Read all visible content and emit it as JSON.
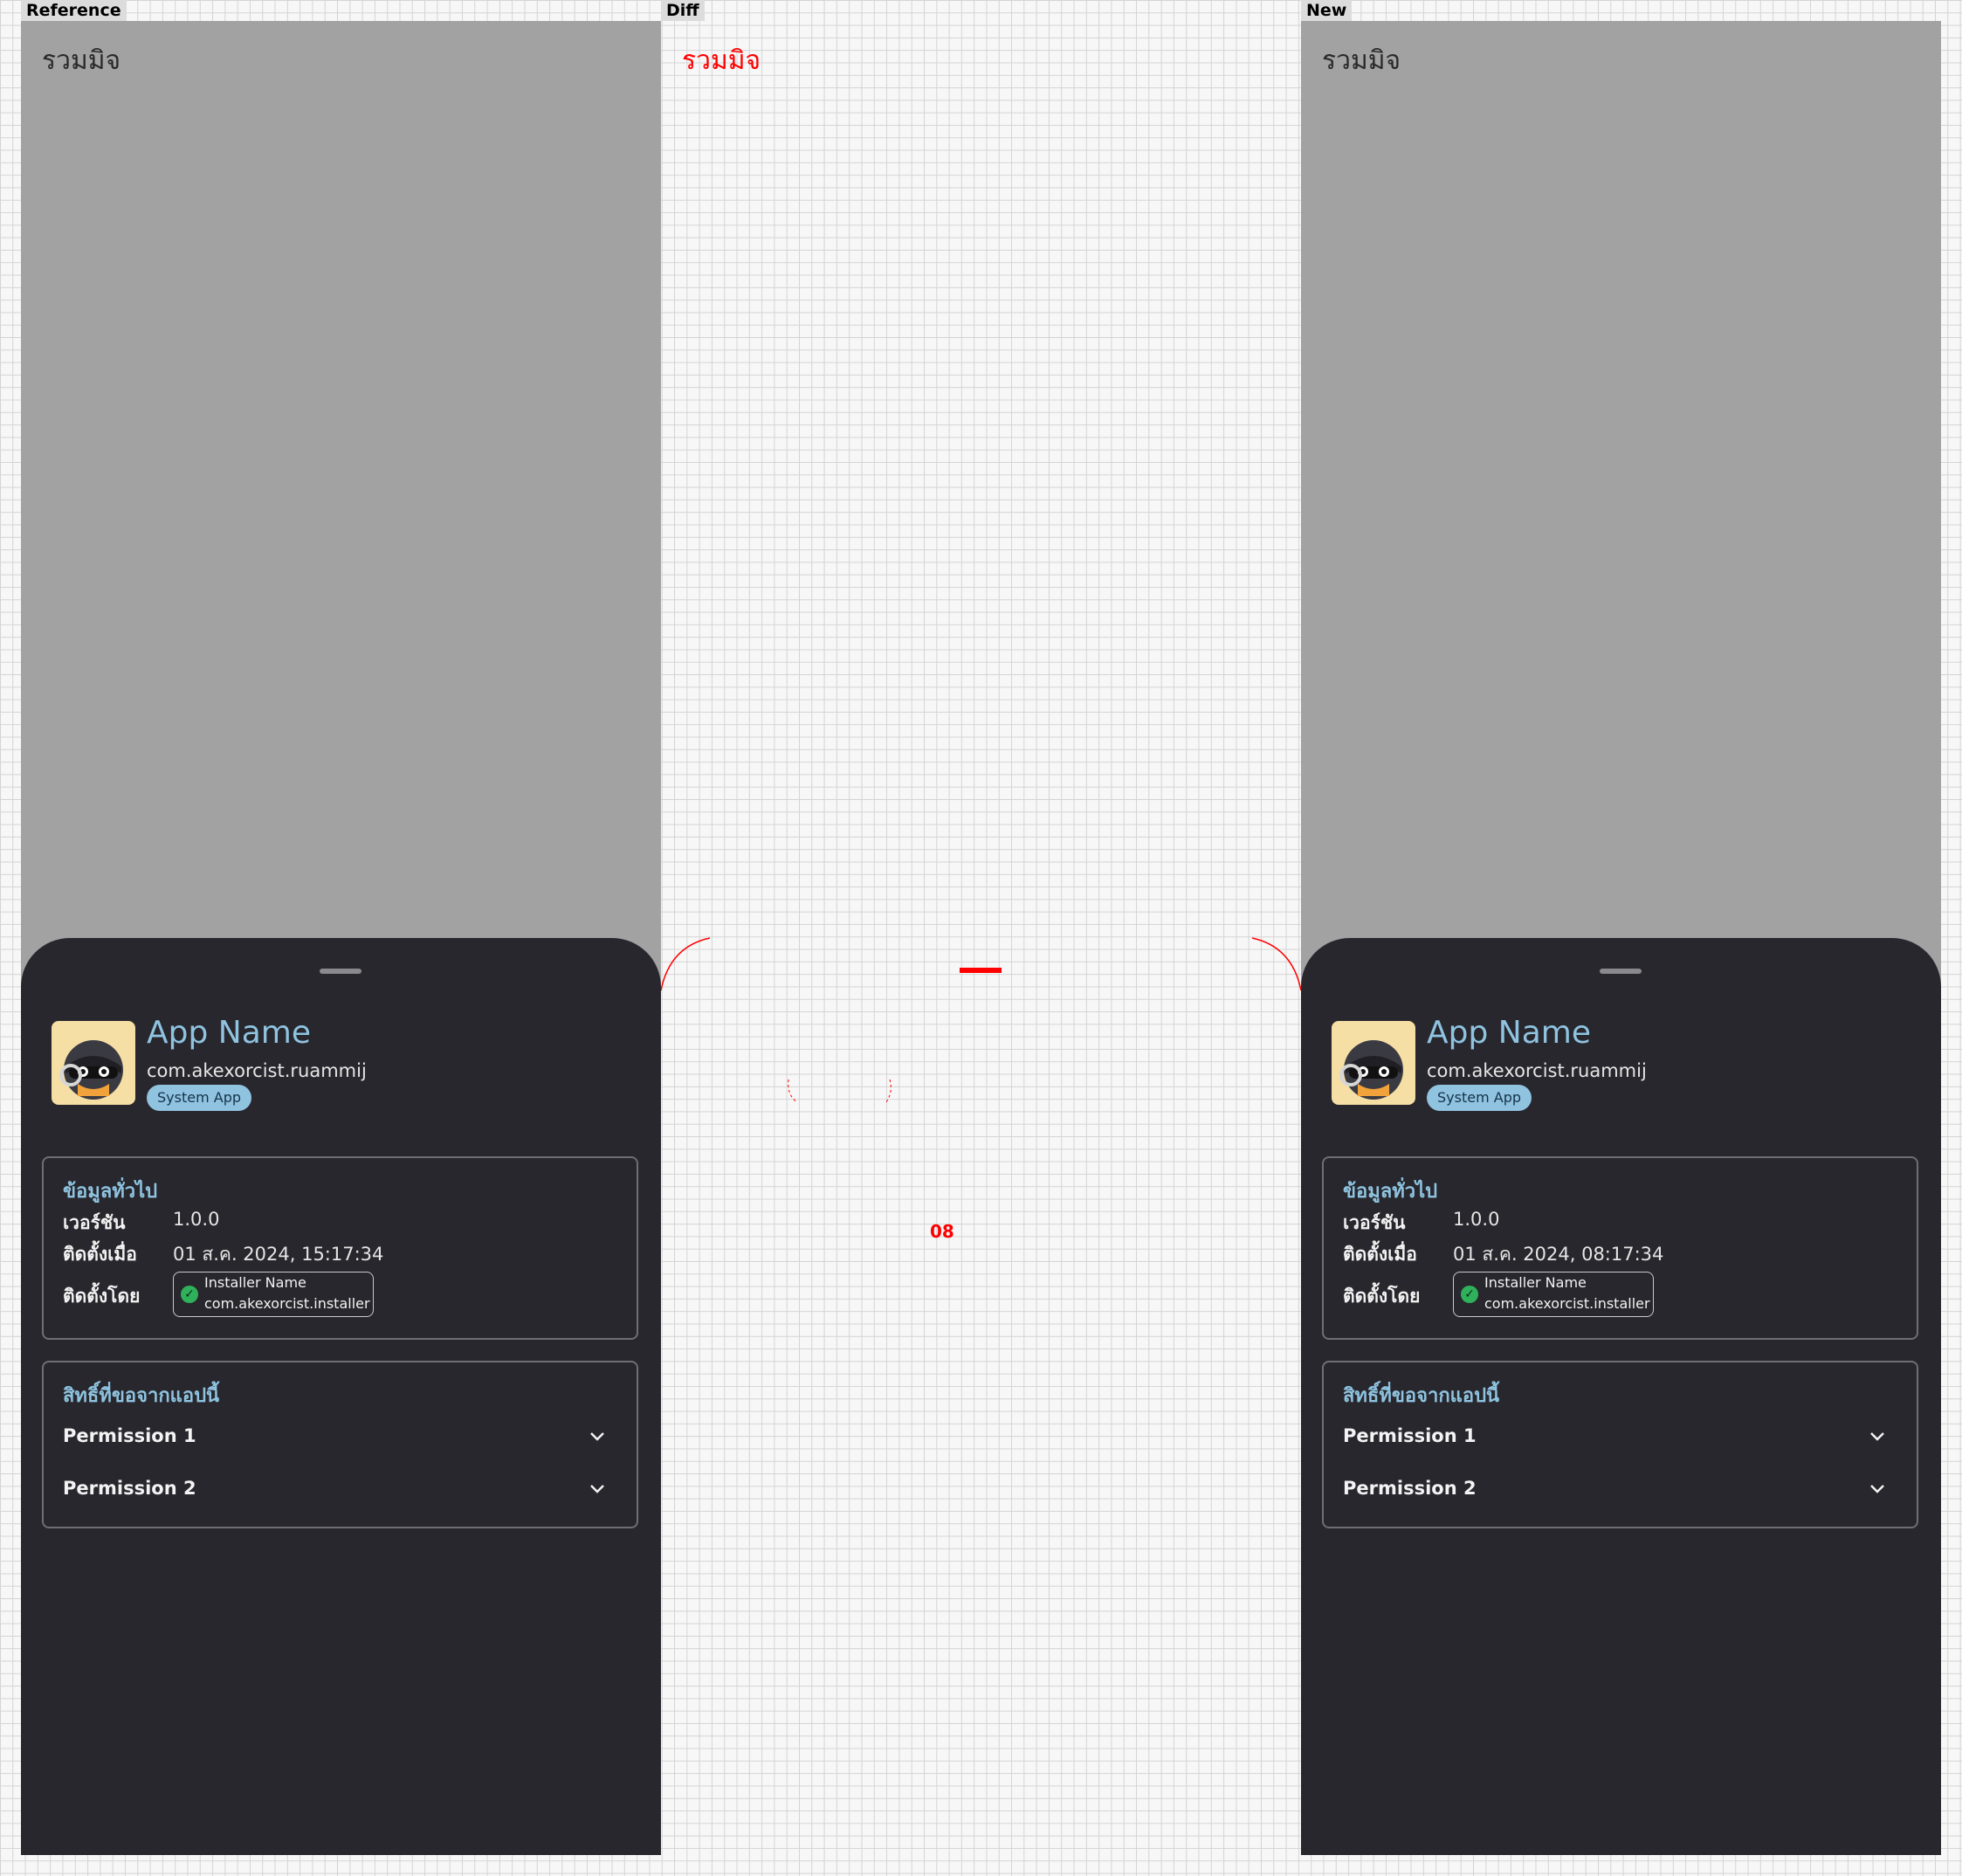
{
  "panels": {
    "reference_label": "Reference",
    "diff_label": "Diff",
    "new_label": "New"
  },
  "screen": {
    "background_title": "รวมมิจ",
    "app_name": "App Name",
    "package": "com.akexorcist.ruammij",
    "badge": "System App",
    "general": {
      "title": "ข้อมูลทั่วไป",
      "version_label": "เวอร์ชัน",
      "version_value": "1.0.0",
      "installed_at_label": "ติดตั้งเมื่อ",
      "installed_by_label": "ติดตั้งโดย",
      "installer_name": "Installer Name",
      "installer_package": "com.akexorcist.installer"
    },
    "permissions": {
      "title": "สิทธิ์ที่ขอจากแอปนี้",
      "items": [
        "Permission 1",
        "Permission 2"
      ]
    }
  },
  "reference": {
    "installed_at_value": "01 ส.ค. 2024, 15:17:34"
  },
  "new": {
    "installed_at_value": "01 ส.ค. 2024, 08:17:34"
  },
  "diff": {
    "changed_text": "08"
  },
  "colors": {
    "accent": "#8fc3e0",
    "sheet": "#27272d",
    "scrim": "#a2a2a3",
    "diff": "#ff0000",
    "check": "#2fb15b"
  }
}
